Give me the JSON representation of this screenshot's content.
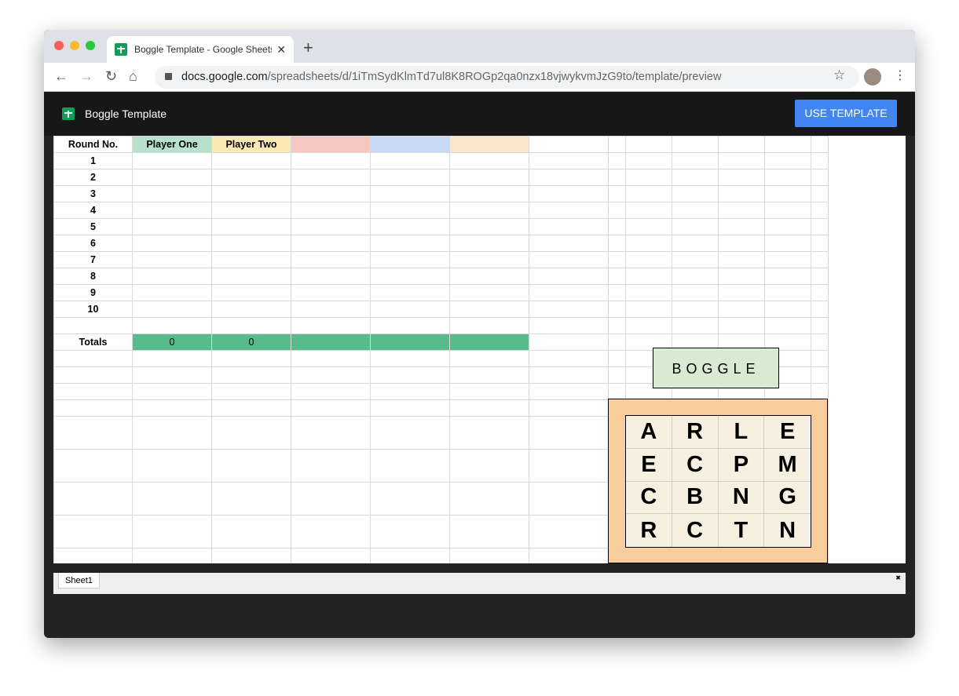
{
  "browser": {
    "tab_title": "Boggle Template - Google Sheets",
    "url_host": "docs.google.com",
    "url_path": "/spreadsheets/d/1iTmSydKlmTd7ul8K8ROGp2qa0nzx18vjwykvmJzG9to/template/preview",
    "new_tab": "+",
    "close": "✕"
  },
  "app": {
    "title": "Boggle Template",
    "use_template": "USE TEMPLATE"
  },
  "scores": {
    "header": [
      "Round No.",
      "Player One",
      "Player Two",
      "",
      "",
      ""
    ],
    "header_colors": [
      "#ffffff",
      "#b7e1cd",
      "#fce8b2",
      "#f4c7c3",
      "#c9daf8",
      "#fce5cd"
    ],
    "rounds": [
      "1",
      "2",
      "3",
      "4",
      "5",
      "6",
      "7",
      "8",
      "9",
      "10"
    ],
    "totals_label": "Totals",
    "totals": [
      "0",
      "0",
      "",
      "",
      ""
    ],
    "totals_color": "#57bb8a"
  },
  "boggle": {
    "title": "BOGGLE",
    "letters": [
      [
        "A",
        "R",
        "L",
        "E"
      ],
      [
        "E",
        "C",
        "P",
        "M"
      ],
      [
        "C",
        "B",
        "N",
        "G"
      ],
      [
        "R",
        "C",
        "T",
        "N"
      ]
    ],
    "frame_color": "#f8cc9b",
    "tile_color": "#f6f0e0"
  },
  "sheets": {
    "tabs": [
      "Sheet1"
    ]
  }
}
